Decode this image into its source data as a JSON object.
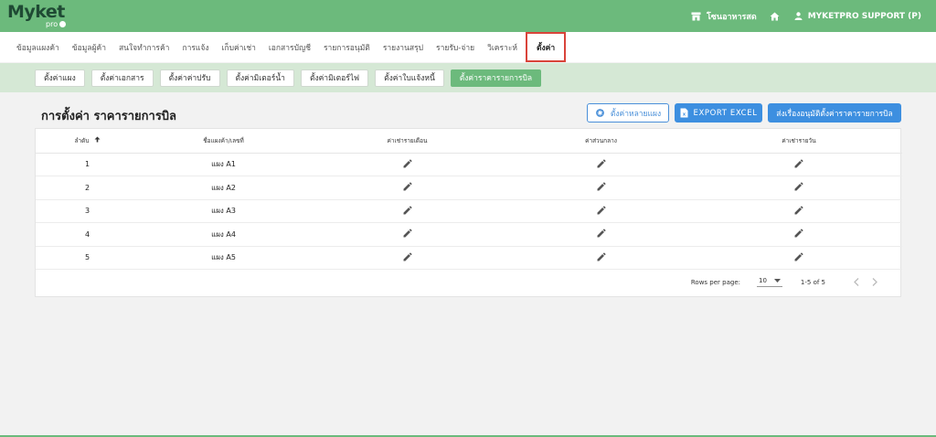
{
  "app": {
    "logo_text": "Myket",
    "logo_sub": "pro"
  },
  "topbar": {
    "store_name": "โซนอาหารสด",
    "user_name": "MYKETPRO SUPPORT (P)"
  },
  "mainnav": {
    "items": [
      {
        "label": "ข้อมูลแผงค้า"
      },
      {
        "label": "ข้อมูลผู้ค้า"
      },
      {
        "label": "สนใจทำการค้า"
      },
      {
        "label": "การแจ้ง"
      },
      {
        "label": "เก็บค่าเช่า"
      },
      {
        "label": "เอกสารบัญชี"
      },
      {
        "label": "รายการอนุมัติ"
      },
      {
        "label": "รายงานสรุป"
      },
      {
        "label": "รายรับ-จ่าย"
      },
      {
        "label": "วิเคราะห์"
      },
      {
        "label": "ตั้งค่า"
      }
    ],
    "active_index": 10
  },
  "subnav": {
    "items": [
      {
        "label": "ตั้งค่าแผง"
      },
      {
        "label": "ตั้งค่าเอกสาร"
      },
      {
        "label": "ตั้งค่าค่าปรับ"
      },
      {
        "label": "ตั้งค่ามิเตอร์น้ำ"
      },
      {
        "label": "ตั้งค่ามิเตอร์ไฟ"
      },
      {
        "label": "ตั้งค่าใบแจ้งหนี้"
      },
      {
        "label": "ตั้งค่าราคารายการบิล"
      }
    ],
    "active_index": 6
  },
  "page": {
    "title": "การตั้งค่า ราคารายการบิล",
    "btn_multi": "ตั้งค่าหลายแผง",
    "btn_export": "EXPORT EXCEL",
    "btn_approve": "ส่งเรื่องอนุมัติตั้งค่าราคารายการบิล"
  },
  "table": {
    "headers": {
      "order": "ลำดับ",
      "stall": "ชื่อแผงค้า/เลขที่",
      "monthly": "ค่าเช่ารายเดือน",
      "common": "ค่าส่วนกลาง",
      "daily": "ค่าเช่ารายวัน"
    },
    "rows": [
      {
        "order": "1",
        "stall": "แผง A1"
      },
      {
        "order": "2",
        "stall": "แผง A2"
      },
      {
        "order": "3",
        "stall": "แผง A3"
      },
      {
        "order": "4",
        "stall": "แผง A4"
      },
      {
        "order": "5",
        "stall": "แผง A5"
      }
    ]
  },
  "pagination": {
    "rows_per_page_label": "Rows per page:",
    "rows_per_page": "10",
    "range": "1-5 of 5"
  },
  "icons": {
    "store": "store-icon",
    "home": "home-icon",
    "user": "user-icon",
    "gear": "gear-icon",
    "excel": "excel-icon",
    "edit": "pencil-icon",
    "sort": "arrow-up-icon"
  },
  "colors": {
    "brand_green": "#6cba7c",
    "sub_green": "#d5e8d5",
    "primary_blue": "#3d8fe0",
    "active_outline": "#d9443a"
  }
}
